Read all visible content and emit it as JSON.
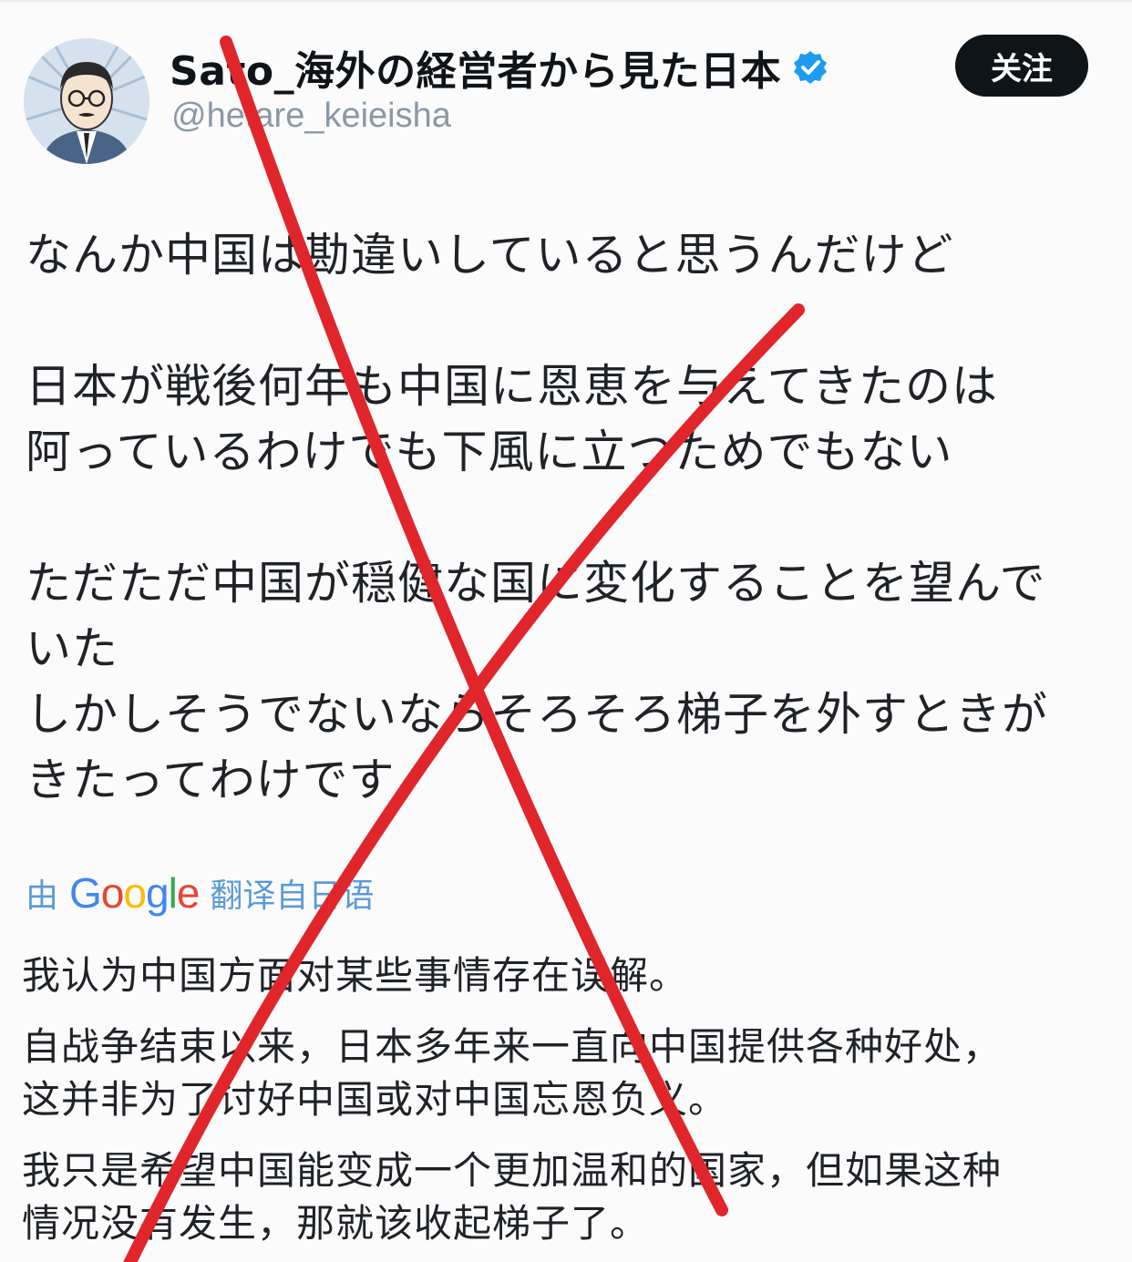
{
  "user": {
    "display_name": "Sato_海外の経営者から見た日本",
    "handle": "@hetare_keieisha",
    "verified": true
  },
  "actions": {
    "follow_label": "关注"
  },
  "tweet": {
    "paragraphs": [
      [
        "なんか中国は勘違いしていると思うんだけど"
      ],
      [
        "日本が戦後何年も中国に恩恵を与えてきたのは",
        "阿っているわけでも下風に立つためでもない"
      ],
      [
        "ただただ中国が穏健な国に変化することを望んで",
        "いた",
        "しかしそうでないならそろそろ梯子を外すときが",
        "きたってわけです"
      ]
    ]
  },
  "translation": {
    "prefix": "由",
    "provider": "Google",
    "suffix": "翻译自日语",
    "lines": [
      "我认为中国方面对某些事情存在误解。",
      "自战争结束以来，日本多年来一直向中国提供各种好处，",
      "这并非为了讨好中国或对中国忘恩负义。",
      "我只是希望中国能变成一个更加温和的国家，但如果这种",
      "情况没有发生，那就该收起梯子了。"
    ]
  },
  "colors": {
    "accent": "#1d9bf0",
    "follow_bg": "#0f1419",
    "translate_link": "#5b9bd5",
    "cross_red": "#e0262b"
  }
}
